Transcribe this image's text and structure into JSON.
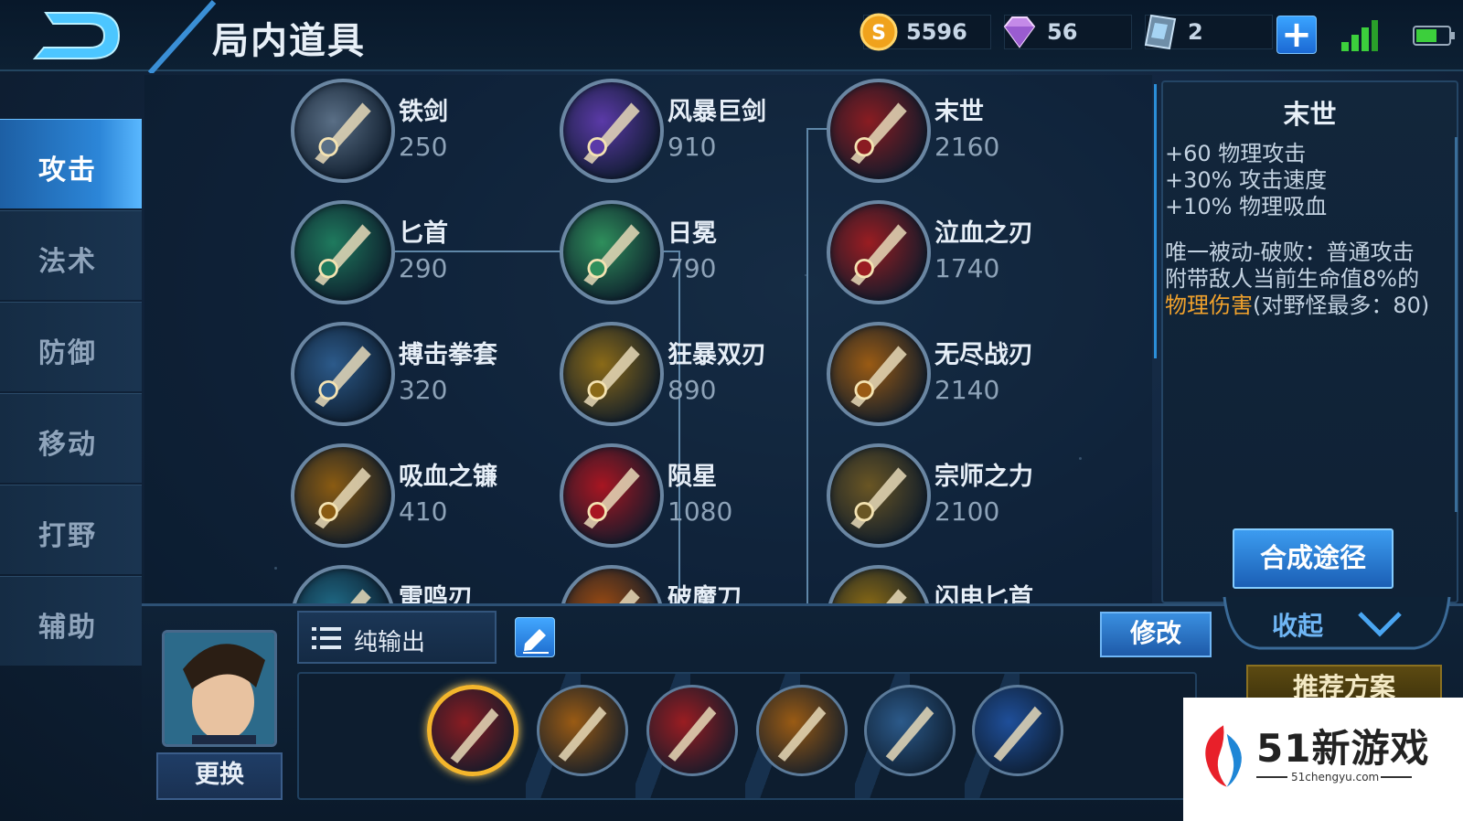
{
  "header": {
    "title": "局内道具"
  },
  "resources": {
    "gold": "5596",
    "diamonds": "56",
    "vouchers": "2"
  },
  "categories": [
    "攻击",
    "法术",
    "防御",
    "移动",
    "打野",
    "辅助"
  ],
  "active_category": "攻击",
  "items": [
    {
      "name": "铁剑",
      "price": "250",
      "icon": "sword-icon",
      "color": "#5a6f86"
    },
    {
      "name": "风暴巨剑",
      "price": "910",
      "icon": "storm-sword-icon",
      "color": "#5b3aa8"
    },
    {
      "name": "末世",
      "price": "2160",
      "icon": "doomsday-blade-icon",
      "color": "#8a1c22"
    },
    {
      "name": "匕首",
      "price": "290",
      "icon": "dagger-icon",
      "color": "#1f7a5e"
    },
    {
      "name": "日冕",
      "price": "790",
      "icon": "corona-axe-icon",
      "color": "#2f8f5c"
    },
    {
      "name": "泣血之刃",
      "price": "1740",
      "icon": "bloodweep-blade-icon",
      "color": "#9a1d22"
    },
    {
      "name": "搏击拳套",
      "price": "320",
      "icon": "fist-glove-icon",
      "color": "#2c5a8a"
    },
    {
      "name": "狂暴双刃",
      "price": "890",
      "icon": "twin-blades-icon",
      "color": "#8a6a18"
    },
    {
      "name": "无尽战刃",
      "price": "2140",
      "icon": "infinity-edge-icon",
      "color": "#9a5b14"
    },
    {
      "name": "吸血之镰",
      "price": "410",
      "icon": "vampire-scythe-icon",
      "color": "#8a5b12"
    },
    {
      "name": "陨星",
      "price": "1080",
      "icon": "meteor-gem-icon",
      "color": "#a81622"
    },
    {
      "name": "宗师之力",
      "price": "2100",
      "icon": "master-power-icon",
      "color": "#6a5624"
    },
    {
      "name": "雷鸣刃",
      "price": "",
      "icon": "thunder-blade-icon",
      "color": "#1f6a86"
    },
    {
      "name": "破魔刀",
      "price": "",
      "icon": "demon-breaker-icon",
      "color": "#9a4a12"
    },
    {
      "name": "闪电匕首",
      "price": "",
      "icon": "lightning-dagger-icon",
      "color": "#8a6a14"
    }
  ],
  "detail": {
    "name": "末世",
    "stats": [
      "+60 物理攻击",
      "+30% 攻击速度",
      "+10% 物理吸血"
    ],
    "passive_line1": "唯一被动-破败：普通攻击",
    "passive_line2": "附带敌人当前生命值8%的",
    "passive_highlight": "物理伤害",
    "passive_line3_rest": "(对野怪最多：80)",
    "compose_label": "合成途径",
    "highlight_color": "#f1a22c"
  },
  "build": {
    "plan_name": "纯输出",
    "swap_label": "更换",
    "modify_label": "修改",
    "collapse_label": "收起",
    "recommend_label": "推荐方案",
    "slots": [
      {
        "icon": "doomsday-blade-icon",
        "color": "#8a1c22"
      },
      {
        "icon": "boots-icon",
        "color": "#9a5b14"
      },
      {
        "icon": "bloodweep-blade-icon",
        "color": "#9a1d22"
      },
      {
        "icon": "infinity-edge-icon",
        "color": "#9a5b14"
      },
      {
        "icon": "bow-icon",
        "color": "#2c5a8a"
      },
      {
        "icon": "armor-icon",
        "color": "#1f4f9a"
      }
    ]
  },
  "watermark": {
    "text": "51新游戏",
    "site": "51chengyu.com"
  }
}
